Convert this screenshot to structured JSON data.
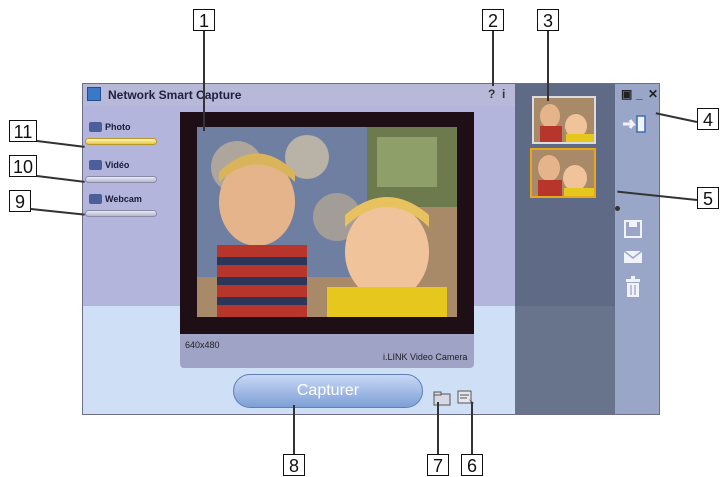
{
  "app": {
    "title": "Network Smart Capture",
    "help_label": "?",
    "info_label": "i"
  },
  "window_controls": {
    "restore": "▣",
    "minimize": "_",
    "close": "✕"
  },
  "modes": [
    {
      "label": "Photo",
      "icon": "camera-icon",
      "active": true
    },
    {
      "label": "Vidéo",
      "icon": "video-icon",
      "active": false
    },
    {
      "label": "Webcam",
      "icon": "webcam-icon",
      "active": false
    }
  ],
  "preview": {
    "resolution": "640x480",
    "camera": "i.LINK Video Camera"
  },
  "capture_button": "Capturer",
  "callouts": [
    "1",
    "2",
    "3",
    "4",
    "5",
    "6",
    "7",
    "8",
    "9",
    "10",
    "11"
  ],
  "colors": {
    "accent": "#e8a619",
    "window_bg": "#b4b5dd",
    "preview_frame": "#1e0f16"
  }
}
